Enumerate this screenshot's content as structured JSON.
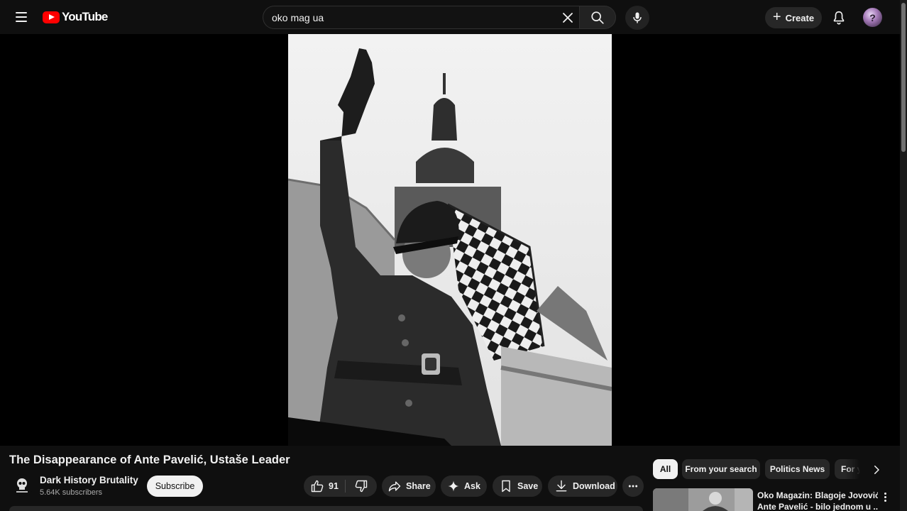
{
  "header": {
    "logo_text": "YouTube",
    "search_value": "oko mag ua",
    "create_label": "Create"
  },
  "video": {
    "title": "The Disappearance of Ante Pavelić, Ustaše Leader"
  },
  "channel": {
    "name": "Dark History Brutality",
    "subscribers": "5.64K subscribers",
    "subscribe_label": "Subscribe"
  },
  "actions": {
    "like_count": "91",
    "share_label": "Share",
    "ask_label": "Ask",
    "save_label": "Save",
    "download_label": "Download"
  },
  "chips": [
    {
      "label": "All",
      "active": true
    },
    {
      "label": "From your search",
      "active": false
    },
    {
      "label": "Politics News",
      "active": false
    },
    {
      "label": "For y",
      "active": false
    }
  ],
  "recommendation": {
    "title_line1": "Oko Magazin: Blagoje Jovović i",
    "title_line2": "Ante Pavelić - bilo jednom u ..."
  },
  "colors": {
    "background": "#0f0f0f",
    "brand_red": "#ff0000",
    "pill_bg": "#272727",
    "subscribe_bg": "#f1f1f1"
  }
}
